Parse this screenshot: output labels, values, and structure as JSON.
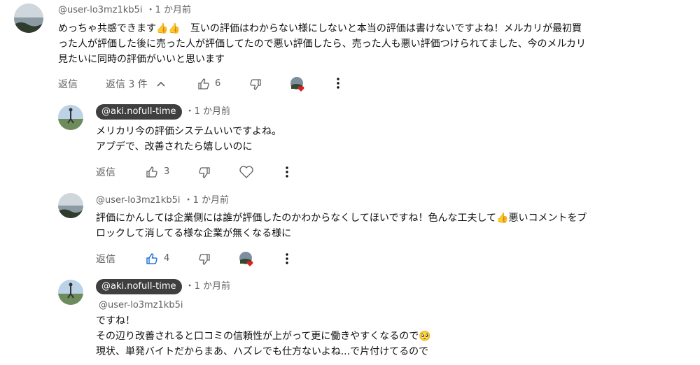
{
  "comment": {
    "author": "@user-lo3mz1kb5i",
    "time": "・1 か月前",
    "text_lines": [
      "めっちゃ共感できます👍👍　互いの評価はわからない様にしないと本当の評価は書けないですよね！メルカリが最初買",
      "った人が評価した後に売った人が評価してたので悪い評価したら、売った人も悪い評価つけられてました、今のメルカリ",
      "見たいに同時の評価がいいと思います"
    ],
    "reply_label": "返信",
    "replies_toggle": "返信 3 件",
    "like_count": "6"
  },
  "replies": [
    {
      "author": "@aki.nofull-time",
      "time": "・1 か月前",
      "text_lines": [
        "メリカリ今の評価システムいいですよね。",
        "アプデで、改善されたら嬉しいのに"
      ],
      "reply_label": "返信",
      "like_count": "3"
    },
    {
      "author": "@user-lo3mz1kb5i",
      "time": "・1 か月前",
      "text_lines": [
        "評価にかんしては企業側には誰が評価したのかわからなくしてほいですね！色んな工夫して👍悪いコメントをブ",
        "ロックして消してる様な企業が無くなる様に"
      ],
      "reply_label": "返信",
      "like_count": "4"
    },
    {
      "author": "@aki.nofull-time",
      "time": "・1 か月前",
      "text_lines": [
        "@user-lo3mz1kb5i",
        "ですね！",
        "その辺り改善されると口コミの信頼性が上がって更に働きやすくなるので🥺",
        "現状、単発バイトだからまあ、ハズレでも仕方ないよね...で片付けてるので"
      ]
    }
  ],
  "icons": {
    "thumb_up": "thumb-up-icon",
    "thumb_down": "thumb-down-icon",
    "heart": "heart-icon",
    "more": "more-vert-icon",
    "chevron_up": "chevron-up-icon",
    "creator_heart": "creator-heart-avatar"
  },
  "colors": {
    "accent_blue": "#065fd4",
    "heart_red": "#e01e1e",
    "chip_bg": "#3f3f3f"
  }
}
